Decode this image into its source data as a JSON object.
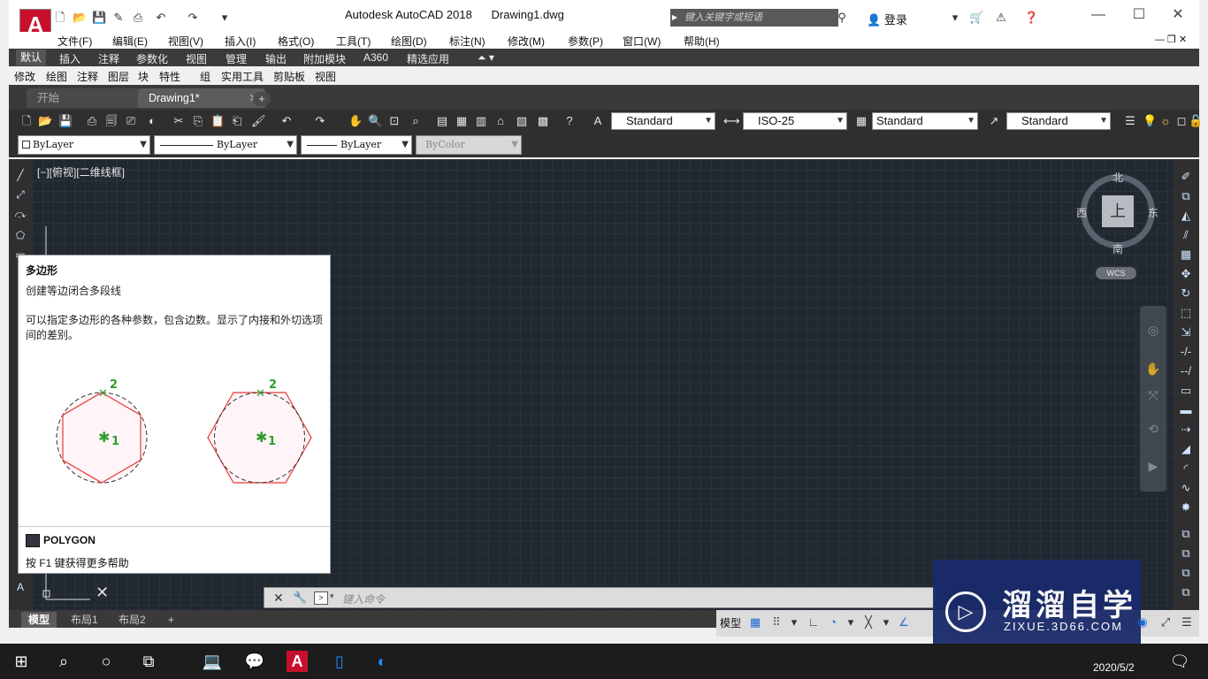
{
  "title_bar": {
    "app_title": "Autodesk AutoCAD 2018",
    "file_name": "Drawing1.dwg",
    "search_placeholder": "键入关键字或短语",
    "login_label": "登录",
    "logo_letter": "A"
  },
  "menu": [
    "文件(F)",
    "编辑(E)",
    "视图(V)",
    "插入(I)",
    "格式(O)",
    "工具(T)",
    "绘图(D)",
    "标注(N)",
    "修改(M)",
    "参数(P)",
    "窗口(W)",
    "帮助(H)"
  ],
  "ribbon_tabs": [
    "默认",
    "插入",
    "注释",
    "参数化",
    "视图",
    "管理",
    "输出",
    "附加模块",
    "A360",
    "精选应用"
  ],
  "ribbon_panels": [
    "修改",
    "绘图",
    "注释",
    "图层",
    "块",
    "特性",
    "组",
    "实用工具",
    "剪贴板",
    "视图"
  ],
  "file_tabs": {
    "start": "开始",
    "drawing": "Drawing1*",
    "add": "+"
  },
  "styles": {
    "text_style": "Standard",
    "dim_style": "ISO-25",
    "table_style": "Standard",
    "mleader_style": "Standard"
  },
  "properties": {
    "layer": "ByLayer",
    "linetype": "ByLayer",
    "lineweight": "ByLayer",
    "color": "ByColor"
  },
  "viewport_label": "[−][俯视][二维线框]",
  "viewcube": {
    "north": "北",
    "south": "南",
    "east": "东",
    "west": "西",
    "top": "上",
    "wcs": "WCS"
  },
  "tooltip": {
    "title": "多边形",
    "subtitle": "创建等边闭合多段线",
    "description": "可以指定多边形的各种参数，包含边数。显示了内接和外切选项间的差别。",
    "label_1": "1",
    "label_2": "2",
    "command": "POLYGON",
    "help": "按 F1 键获得更多帮助"
  },
  "command_line": {
    "placeholder": "键入命令"
  },
  "layout_tabs": [
    "模型",
    "布局1",
    "布局2",
    "+"
  ],
  "status_bar": {
    "model": "模型"
  },
  "taskbar": {
    "date": "2020/5/2"
  },
  "watermark": {
    "cn": "溜溜自学",
    "en": "ZIXUE.3D66.COM"
  },
  "colors": {
    "accent_red": "#c8102e",
    "canvas": "#212830",
    "tooltip_red": "#e53935",
    "tooltip_green": "#2e9e2e"
  }
}
